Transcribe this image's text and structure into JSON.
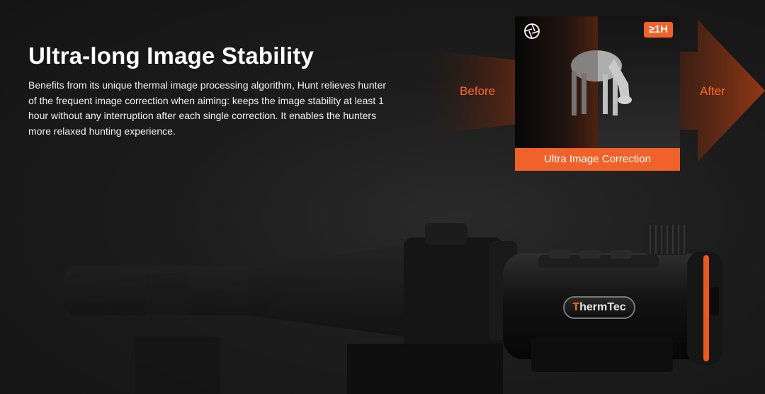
{
  "section": {
    "title": "Ultra-long Image Stability",
    "description": "Benefits from its unique thermal image processing algorithm, Hunt relieves hunter of the frequent image correction when aiming: keeps the image stability at least 1 hour without any interruption after each single correction. It enables the hunters more relaxed hunting experience."
  },
  "comparison": {
    "before_label": "Before",
    "after_label": "After",
    "badge": "≥1H",
    "caption": "Ultra Image Correction",
    "icon": "aperture-icon",
    "accent_color": "#f0622a"
  },
  "product": {
    "brand_first": "T",
    "brand_rest": "hermTec"
  }
}
